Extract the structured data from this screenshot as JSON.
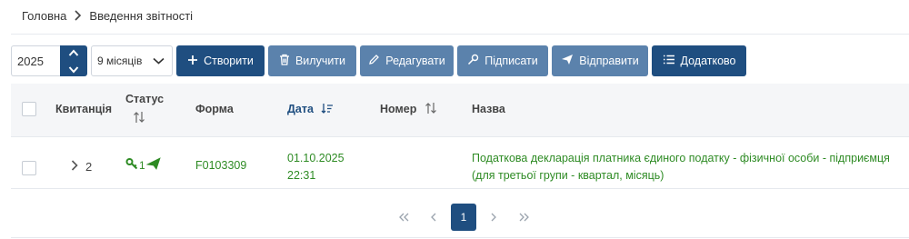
{
  "breadcrumb": {
    "home": "Головна",
    "current": "Введення звітності"
  },
  "toolbar": {
    "year": "2025",
    "period": "9 місяців",
    "buttons": {
      "create": "Створити",
      "delete": "Вилучити",
      "edit": "Редагувати",
      "sign": "Підписати",
      "send": "Відправити",
      "more": "Додатково"
    }
  },
  "table": {
    "headers": {
      "receipt": "Квитанція",
      "status": "Статус",
      "form": "Форма",
      "date": "Дата",
      "number": "Номер",
      "name": "Назва"
    },
    "rows": [
      {
        "receipt_count": "2",
        "status_count": "1",
        "form": "F0103309",
        "date": "01.10.2025",
        "time": "22:31",
        "number": "",
        "name": "Податкова декларація платника єдиного податку - фізичної особи - підприємця (для третьої групи - квартал, місяць)"
      }
    ]
  },
  "pagination": {
    "current": "1"
  },
  "colors": {
    "primary": "#1f4e80",
    "secondary": "#5b82ac",
    "success": "#2e8b24"
  }
}
